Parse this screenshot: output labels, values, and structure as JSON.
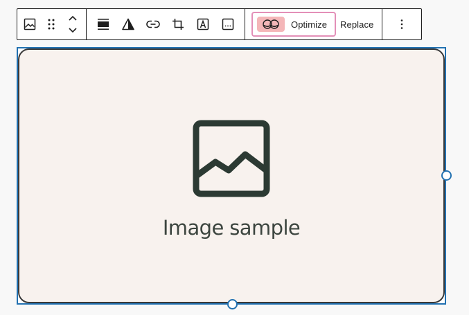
{
  "toolbar": {
    "block_group": {
      "items": [
        {
          "icon": "image-block-icon"
        },
        {
          "icon": "drag-handle-icon"
        },
        {
          "icon": "move-up-down-icon"
        }
      ]
    },
    "format_group": {
      "items": [
        {
          "icon": "align-icon"
        },
        {
          "icon": "duotone-filter-icon"
        },
        {
          "icon": "link-icon"
        },
        {
          "icon": "crop-icon"
        },
        {
          "icon": "text-overlay-icon"
        },
        {
          "icon": "alt-text-icon"
        }
      ]
    },
    "optimize_label": "Optimize",
    "replace_label": "Replace",
    "more_icon": "more-options-icon"
  },
  "image": {
    "caption": "Image sample",
    "placeholder_icon": "image-placeholder-icon"
  },
  "colors": {
    "selection_border": "#2271b1",
    "image_background": "#f8f2ee",
    "icon_color": "#2c3a33",
    "optimize_border": "#e38fb8",
    "optimize_badge": "#f4b6b8"
  }
}
